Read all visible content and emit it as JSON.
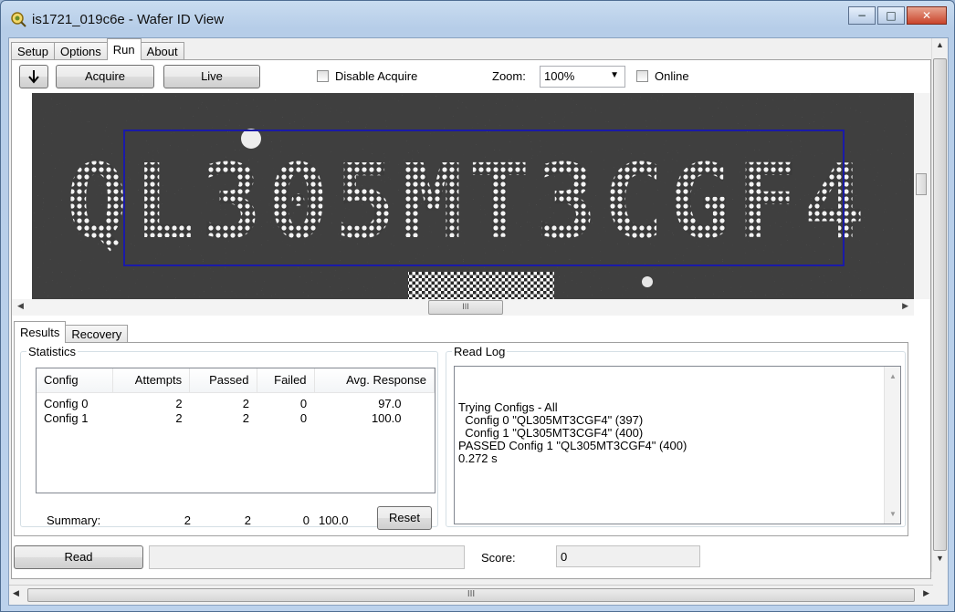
{
  "window": {
    "title": "is1721_019c6e - Wafer ID View",
    "minimize_glyph": "−",
    "maximize_glyph": "□",
    "close_glyph": "✕"
  },
  "tabs": [
    {
      "label": "Setup"
    },
    {
      "label": "Options"
    },
    {
      "label": "Run"
    },
    {
      "label": "About"
    }
  ],
  "active_tab": "Run",
  "toolbar": {
    "download_icon": "arrow-down-icon",
    "acquire_label": "Acquire",
    "live_label": "Live",
    "disable_acquire_label": "Disable Acquire",
    "zoom_label": "Zoom:",
    "zoom_value": "100%",
    "online_label": "Online"
  },
  "image": {
    "wafer_id_text": "QL305MT3CGF4",
    "roi_color": "#1a1aa8"
  },
  "subtabs": [
    {
      "label": "Results"
    },
    {
      "label": "Recovery"
    }
  ],
  "statistics": {
    "legend": "Statistics",
    "columns": [
      "Config",
      "Attempts",
      "Passed",
      "Failed",
      "Avg. Response"
    ],
    "rows": [
      [
        "Config 0",
        "2",
        "2",
        "0",
        "97.0"
      ],
      [
        "Config 1",
        "2",
        "2",
        "0",
        "100.0"
      ]
    ],
    "summary_label": "Summary:",
    "summary": {
      "attempts": "2",
      "passed": "2",
      "failed": "0",
      "avg": "100.0"
    },
    "reset_label": "Reset"
  },
  "read_log": {
    "legend": "Read Log",
    "lines": [
      "Trying Configs - All",
      "  Config 0 \"QL305MT3CGF4\" (397)",
      "  Config 1 \"QL305MT3CGF4\" (400)",
      "PASSED Config 1 \"QL305MT3CGF4\" (400)",
      "0.272 s"
    ]
  },
  "bottom": {
    "read_label": "Read",
    "status_value": "",
    "score_label": "Score:",
    "score_value": "0"
  },
  "scroll_grip": "III"
}
